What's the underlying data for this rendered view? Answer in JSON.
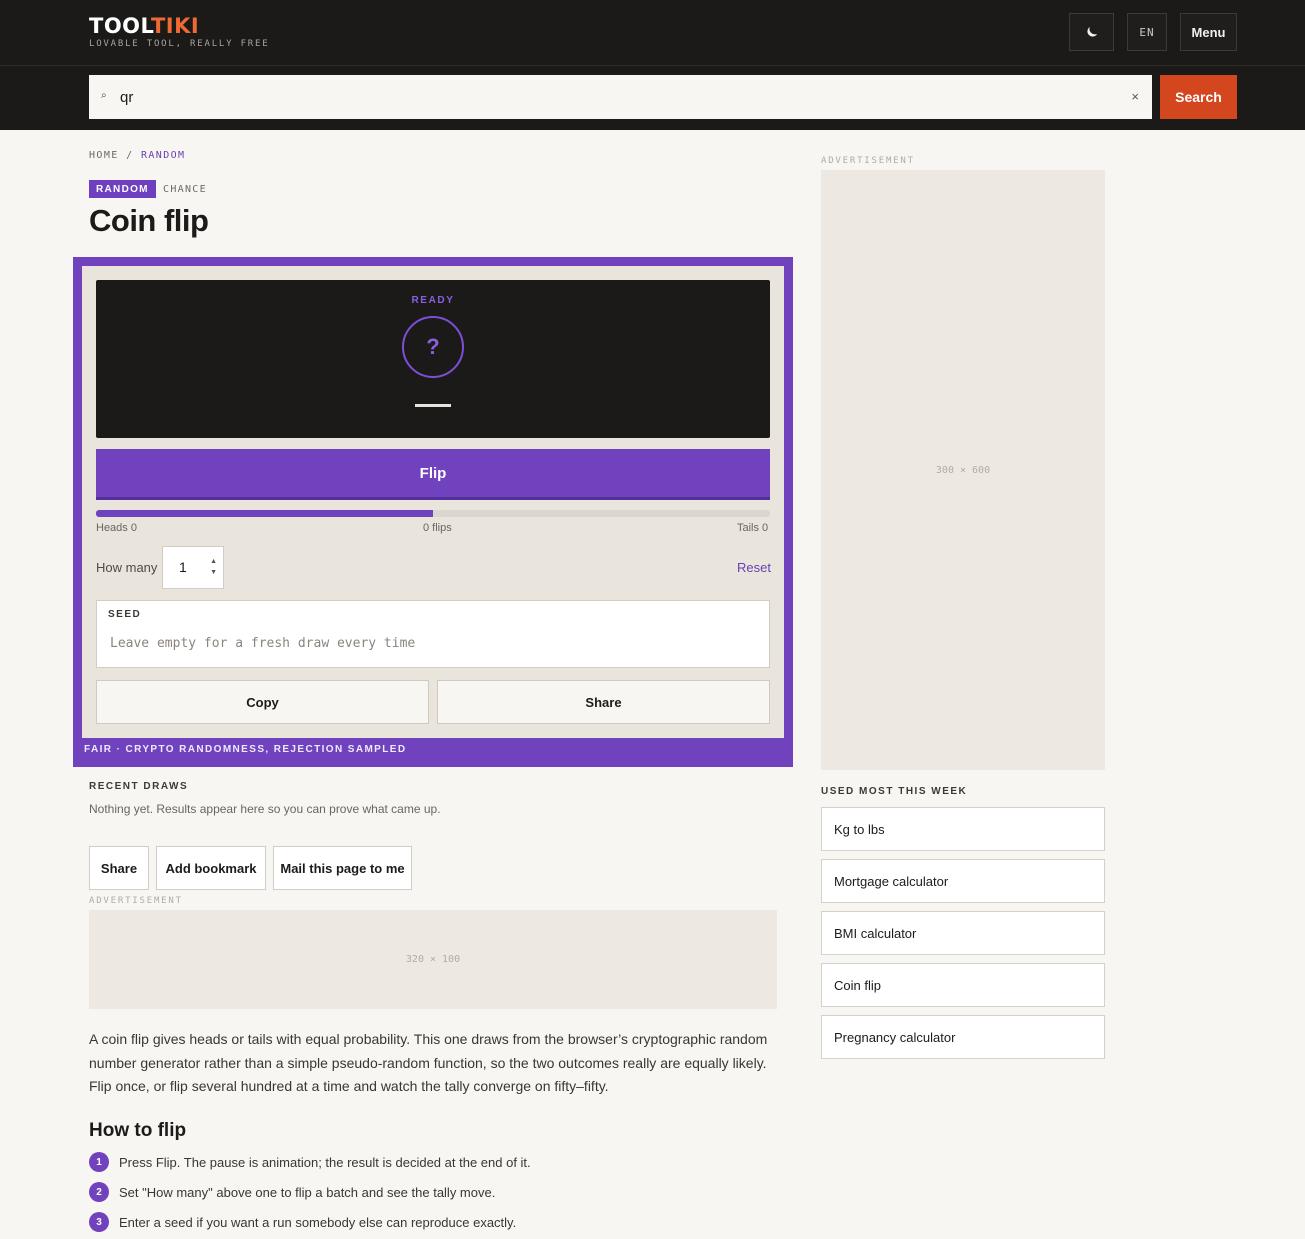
{
  "header": {
    "logo_main": "TOOL",
    "logo_accent": "TIKI",
    "tagline": "LOVABLE TOOL, REALLY FREE",
    "lang": "EN",
    "menu_label": "Menu",
    "theme_icon": "moon-icon"
  },
  "search": {
    "value": "qr",
    "icon": "search-icon",
    "clear": "×",
    "button": "Search"
  },
  "breadcrumb": {
    "home": "HOME",
    "sep": "/",
    "current": "RANDOM"
  },
  "category": {
    "badge": "RANDOM",
    "sub": "CHANCE"
  },
  "title": "Coin flip",
  "tool": {
    "state": "READY",
    "coin_face": "?",
    "flip_label": "Flip",
    "tally": {
      "heads": "Heads 0",
      "total": "0 flips",
      "tails": "Tails 0",
      "heads_fraction": 0.5
    },
    "howmany_label": "How many",
    "howmany_value": "1",
    "reset": "Reset",
    "seed_label": "SEED",
    "seed_placeholder": "Leave empty for a fresh draw every time",
    "copy": "Copy",
    "share": "Share",
    "fair_note": "FAIR · CRYPTO RANDOMNESS, REJECTION SAMPLED"
  },
  "recent": {
    "heading": "RECENT DRAWS",
    "empty": "Nothing yet. Results appear here so you can prove what came up."
  },
  "actions": {
    "share": "Share",
    "bookmark": "Add bookmark",
    "mail": "Mail this page to me"
  },
  "ads": {
    "label": "ADVERTISEMENT",
    "inline_size": "320 × 100",
    "side_size": "300 × 600"
  },
  "intro": "A coin flip gives heads or tails with equal probability. This one draws from the browser’s cryptographic random number generator rather than a simple pseudo-random function, so the two outcomes really are equally likely. Flip once, or flip several hundred at a time and watch the tally converge on fifty–fifty.",
  "howto": {
    "heading": "How to flip",
    "steps": [
      {
        "num": "1",
        "text": "Press Flip. The pause is animation; the result is decided at the end of it."
      },
      {
        "num": "2",
        "text": "Set \"How many\" above one to flip a batch and see the tally move."
      },
      {
        "num": "3",
        "text": "Enter a seed if you want a run somebody else can reproduce exactly."
      }
    ]
  },
  "sidebar": {
    "heading": "USED MOST THIS WEEK",
    "items": [
      {
        "label": "Kg to lbs"
      },
      {
        "label": "Mortgage calculator"
      },
      {
        "label": "BMI calculator"
      },
      {
        "label": "Coin flip"
      },
      {
        "label": "Pregnancy calculator"
      }
    ]
  }
}
